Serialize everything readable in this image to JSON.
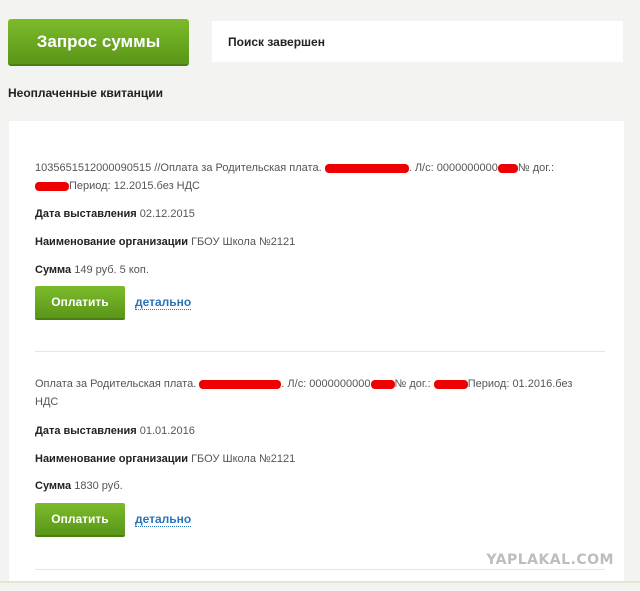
{
  "header": {
    "request_button_label": "Запрос суммы",
    "status_text": "Поиск завершен"
  },
  "section_title": "Неоплаченные квитанции",
  "receipts": [
    {
      "desc_part1": "1035651512000090515 //Оплата за Родительская плата.",
      "desc_part2": ". Л/с: 0000000000",
      "desc_part3": "№ дог.:",
      "desc_part4": "Период: 12.2015.без НДС",
      "date_label": "Дата выставления",
      "date_value": "02.12.2015",
      "org_label": "Наименование организации",
      "org_value": "ГБОУ Школа №2121",
      "sum_label": "Сумма",
      "sum_value": "149 руб. 5 коп.",
      "pay_label": "Оплатить",
      "detail_label": "детально"
    },
    {
      "desc_part1": "Оплата за Родительская плата.",
      "desc_part2": ". Л/с: 0000000000",
      "desc_part3": "№ дог.:",
      "desc_part4": "Период: 01.2016.без",
      "desc_part5": "НДС",
      "date_label": "Дата выставления",
      "date_value": "01.01.2016",
      "org_label": "Наименование организации",
      "org_value": "ГБОУ Школа №2121",
      "sum_label": "Сумма",
      "sum_value": "1830 руб.",
      "pay_label": "Оплатить",
      "detail_label": "детально"
    }
  ],
  "watermark": "YAPLAKAL.COM",
  "colors": {
    "button_green": "#6aa821",
    "link_blue": "#2a73b8",
    "redaction_red": "#ee0000"
  }
}
